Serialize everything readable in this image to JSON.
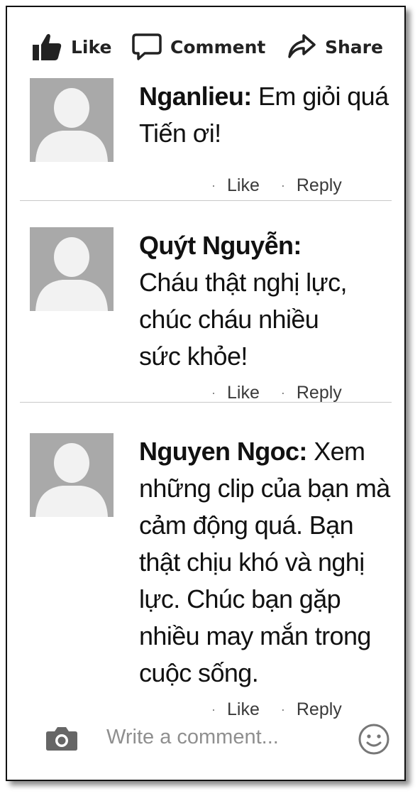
{
  "actions": {
    "like": "Like",
    "comment": "Comment",
    "share": "Share"
  },
  "comments": [
    {
      "author": "Nganlieu:",
      "text": "Em giỏi quá Tiến ơi!",
      "like": "Like",
      "reply": "Reply"
    },
    {
      "author": "Quýt Nguyễn:",
      "text": "Cháu thật nghị lực, chúc cháu nhiều sức khỏe!",
      "like": "Like",
      "reply": "Reply"
    },
    {
      "author": "Nguyen Ngoc:",
      "text": "Xem những clip của bạn mà cảm động quá. Bạn thật chịu khó và nghị lực. Chúc bạn gặp nhiều may mắn trong cuộc sống.",
      "like": "Like",
      "reply": "Reply"
    }
  ],
  "composer": {
    "placeholder": "Write a comment..."
  },
  "icons": {
    "like": "thumbs-up-icon",
    "comment": "speech-bubble-icon",
    "share": "share-arrow-icon",
    "camera": "camera-icon",
    "emoji": "smiley-icon",
    "avatar": "default-avatar-icon"
  },
  "colors": {
    "avatar_bg": "#a9a9a9",
    "icon": "#333333",
    "placeholder": "#8f8f8f"
  }
}
